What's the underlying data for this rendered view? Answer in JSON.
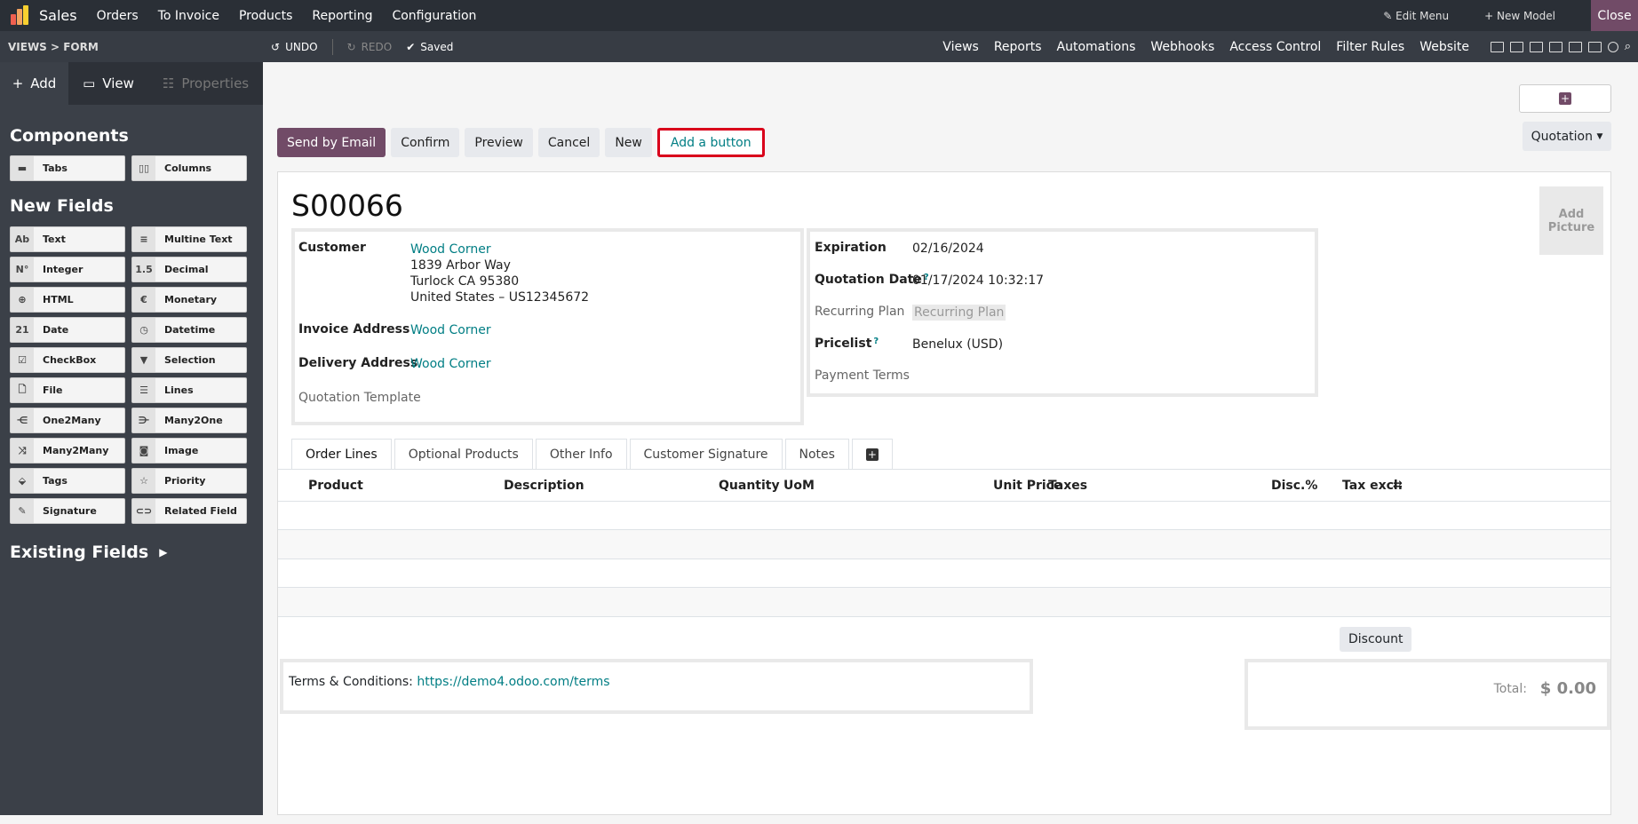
{
  "topbar": {
    "app_name": "Sales",
    "menu": [
      "Orders",
      "To Invoice",
      "Products",
      "Reporting",
      "Configuration"
    ],
    "edit_menu": "Edit Menu",
    "new_model": "New Model",
    "close": "Close"
  },
  "studiobar": {
    "breadcrumb": "VIEWS > FORM",
    "undo": "UNDO",
    "redo": "REDO",
    "saved": "Saved",
    "nav": [
      "Views",
      "Reports",
      "Automations",
      "Webhooks",
      "Access Control",
      "Filter Rules",
      "Website"
    ]
  },
  "sidebar": {
    "tabs": {
      "add": "Add",
      "view": "View",
      "properties": "Properties"
    },
    "components_title": "Components",
    "components": [
      {
        "icon": "▬",
        "label": "Tabs"
      },
      {
        "icon": "▯▯",
        "label": "Columns"
      }
    ],
    "new_fields_title": "New Fields",
    "fields": [
      {
        "icon": "Ab",
        "label": "Text"
      },
      {
        "icon": "≡",
        "label": "Multine Text"
      },
      {
        "icon": "N°",
        "label": "Integer"
      },
      {
        "icon": "1.5",
        "label": "Decimal"
      },
      {
        "icon": "⊕",
        "label": "HTML"
      },
      {
        "icon": "€",
        "label": "Monetary"
      },
      {
        "icon": "21",
        "label": "Date"
      },
      {
        "icon": "◷",
        "label": "Datetime"
      },
      {
        "icon": "☑",
        "label": "CheckBox"
      },
      {
        "icon": "▼",
        "label": "Selection"
      },
      {
        "icon": "🗋",
        "label": "File"
      },
      {
        "icon": "☰",
        "label": "Lines"
      },
      {
        "icon": "⋲",
        "label": "One2Many"
      },
      {
        "icon": "⋺",
        "label": "Many2One"
      },
      {
        "icon": "⤨",
        "label": "Many2Many"
      },
      {
        "icon": "◙",
        "label": "Image"
      },
      {
        "icon": "⬙",
        "label": "Tags"
      },
      {
        "icon": "☆",
        "label": "Priority"
      },
      {
        "icon": "✎",
        "label": "Signature"
      },
      {
        "icon": "⊂⊃",
        "label": "Related Field"
      }
    ],
    "existing_fields": "Existing Fields"
  },
  "form": {
    "buttons": [
      "Send by Email",
      "Confirm",
      "Preview",
      "Cancel",
      "New"
    ],
    "add_button": "Add a button",
    "status": "Quotation",
    "record_name": "S00066",
    "add_picture": "Add Picture",
    "customer_label": "Customer",
    "customer_name": "Wood Corner",
    "customer_address": [
      "1839 Arbor Way",
      "Turlock CA 95380",
      "United States – US12345672"
    ],
    "invoice_label": "Invoice Address",
    "invoice_value": "Wood Corner",
    "delivery_label": "Delivery Address",
    "delivery_value": "Wood Corner",
    "template_label": "Quotation Template",
    "expiration_label": "Expiration",
    "expiration_value": "02/16/2024",
    "qdate_label": "Quotation Date",
    "qdate_value": "01/17/2024 10:32:17",
    "recurring_label": "Recurring Plan",
    "recurring_placeholder": "Recurring Plan",
    "pricelist_label": "Pricelist",
    "pricelist_value": "Benelux (USD)",
    "payment_label": "Payment Terms",
    "tooltip_mark": "?",
    "tabs": [
      "Order Lines",
      "Optional Products",
      "Other Info",
      "Customer Signature",
      "Notes"
    ],
    "columns": [
      "Product",
      "Description",
      "Quantity",
      "UoM",
      "Unit Price",
      "Taxes",
      "Disc.%",
      "Tax excl."
    ],
    "discount": "Discount",
    "terms_label": "Terms & Conditions:",
    "terms_link": "https://demo4.odoo.com/terms",
    "total_label": "Total:",
    "total_value": "$ 0.00"
  },
  "colors": {
    "brand": "#714b67",
    "link": "#017e84",
    "highlight": "#d9001b"
  }
}
